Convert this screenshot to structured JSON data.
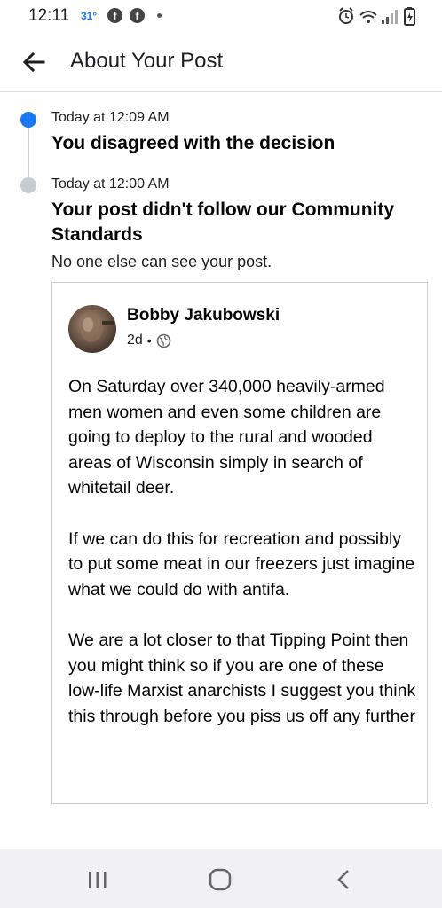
{
  "status_bar": {
    "time": "12:11",
    "temperature": "31°",
    "app_icons": [
      "facebook-icon",
      "facebook-icon"
    ],
    "right_icons": [
      "alarm-icon",
      "wifi-icon",
      "signal-icon",
      "battery-icon"
    ]
  },
  "header": {
    "title": "About Your Post",
    "back_icon": "back-arrow-icon"
  },
  "timeline": [
    {
      "time": "Today at 12:09 AM",
      "title": "You disagreed with the decision",
      "dot_color": "#1877f2"
    },
    {
      "time": "Today at 12:00 AM",
      "title": "Your post didn't follow our Community Standards",
      "subtitle": "No one else can see your post.",
      "dot_color": "#c7ccd1"
    }
  ],
  "post": {
    "author": "Bobby Jakubowski",
    "age": "2d",
    "separator": "•",
    "privacy_icon": "globe-icon",
    "paragraphs": [
      "On Saturday over 340,000 heavily-armed men women and even some children are going to deploy to the rural and wooded areas of Wisconsin simply in search of whitetail deer.",
      "If we can do this for recreation and possibly to put some meat in our freezers just imagine what we could do with antifa.",
      "We are a lot closer to that Tipping Point then you might think so if you are one of these low-life Marxist anarchists I suggest you think this through before you piss us off any further"
    ]
  },
  "nav_bar": {
    "buttons": [
      "recent-apps-icon",
      "home-icon",
      "back-icon"
    ]
  }
}
